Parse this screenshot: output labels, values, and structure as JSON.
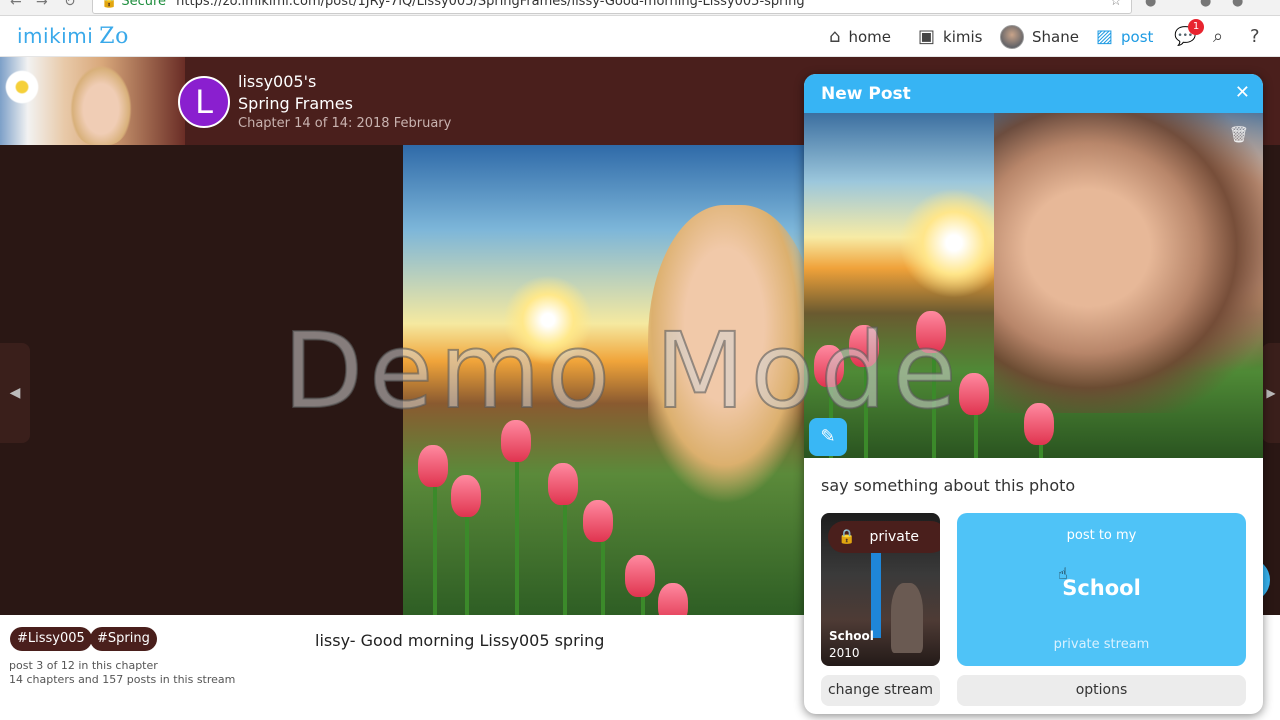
{
  "browser": {
    "secure_label": "Secure",
    "url": "https://zo.imikimi.com/post/1JRy-7iQ/Lissy005/SpringFrames/lissy-Good-morning-Lissy005-spring"
  },
  "nav": {
    "brand": "imikimi",
    "brand_suffix": "Zo",
    "items": [
      {
        "label": "home",
        "icon": "home-icon"
      },
      {
        "label": "kimis",
        "icon": "kimis-bag-icon"
      },
      {
        "label": "Shane",
        "icon": "user-avatar"
      },
      {
        "label": "post",
        "icon": "image-icon"
      }
    ],
    "notifications_count": "1",
    "accent_color": "#1e9be3"
  },
  "chapter": {
    "avatar_letter": "L",
    "owner": "lissy005's",
    "title": "Spring Frames",
    "subtitle": "Chapter 14 of 14: 2018 February"
  },
  "watermark": "Demo Mode",
  "post": {
    "tags": [
      "#Lissy005",
      "#Spring"
    ],
    "caption": "lissy- Good morning Lissy005 spring",
    "position_text": "post 3 of 12 in this chapter",
    "stream_stats": "14 chapters and 157 posts in this stream"
  },
  "new_post": {
    "title": "New Post",
    "say_placeholder": "say something about this photo",
    "privacy_label": "private",
    "stream_thumb_name": "School",
    "stream_thumb_year": "2010",
    "post_to_label": "post to my",
    "stream_name": "School",
    "stream_type": "private stream",
    "change_stream_label": "change stream",
    "options_label": "options",
    "header_color": "#37b4f4"
  }
}
